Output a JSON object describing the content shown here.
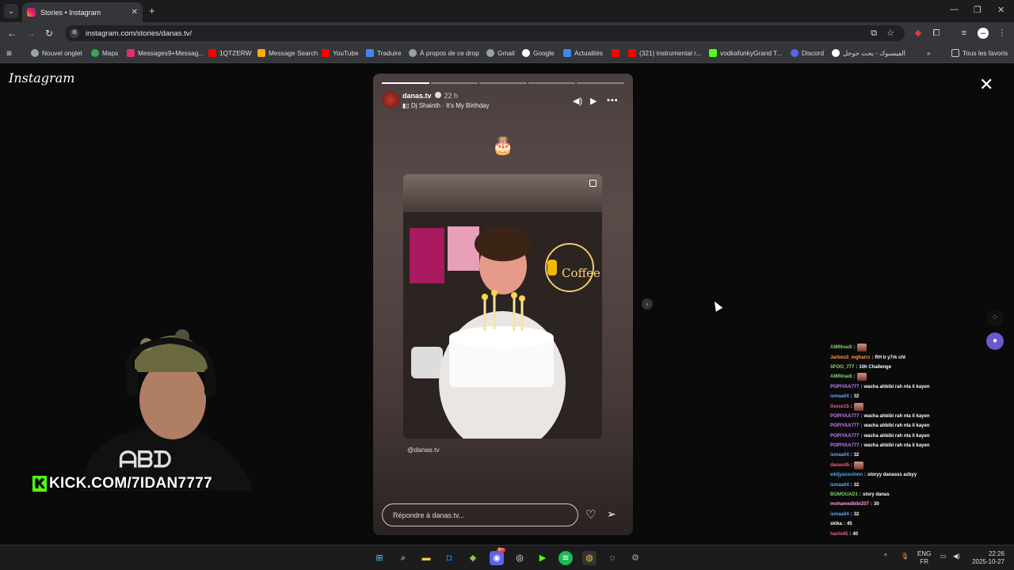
{
  "browser": {
    "tab_title": "Stories • Instagram",
    "url": "instagram.com/stories/danas.tv/",
    "bookmarks": [
      "Nouvel onglet",
      "Maps",
      "Messages9+Messag...",
      "1QTZERW",
      "Message Search",
      "YouTube",
      "Traduire",
      "À propos de ce drop",
      "Gmail",
      "Google",
      "Actualités",
      "(321) instrumental r...",
      "vodkafunkyGrand T...",
      "Discord",
      "الفيسبوك - بحث جوجل",
      "Tous les favoris"
    ],
    "accent_color": "#e1306c"
  },
  "instagram": {
    "logo": "Instagram",
    "story": {
      "username": "danas.tv",
      "time": "22 h",
      "song": "Dj Shainth · It's My Birthday",
      "sticker": "🎂",
      "mention": "@danas.tv",
      "reply_placeholder": "Répondre à danas.tv...",
      "progress_segments": 5,
      "progress_current": 1
    }
  },
  "stream": {
    "kick_url": "KICK.COM/7IDAN7777",
    "kick_color": "#53fc18",
    "chat": [
      {
        "user": "AMINnadi",
        "color": "#7bd36b",
        "text": "",
        "emote": true
      },
      {
        "user": "Jarbou3_mgharrz",
        "color": "#ff9f3a",
        "text": "RH b y7rk cht",
        "emote": false
      },
      {
        "user": "SFOO_777",
        "color": "#88e070",
        "text": "10h Challenge",
        "emote": false
      },
      {
        "user": "AMINnadi",
        "color": "#7bd36b",
        "text": "",
        "emote": true
      },
      {
        "user": "POPIYAA777",
        "color": "#c77dff",
        "text": "wacha ahbibi rah nta li kayen",
        "emote": false
      },
      {
        "user": "ismaa04",
        "color": "#5aa7ff",
        "text": "32",
        "emote": false
      },
      {
        "user": "Ilvoxx15",
        "color": "#ff5a8a",
        "text": "",
        "emote": true
      },
      {
        "user": "POPIYAA777",
        "color": "#c77dff",
        "text": "wacha ahbibi rah nta li kayen",
        "emote": false
      },
      {
        "user": "POPIYAA777",
        "color": "#c77dff",
        "text": "wacha ahbibi rah nta li kayen",
        "emote": false
      },
      {
        "user": "POPIYAA777",
        "color": "#c77dff",
        "text": "wacha ahbibi rah nta li kayen",
        "emote": false
      },
      {
        "user": "POPIYAA777",
        "color": "#c77dff",
        "text": "wacha ahbibi rah nta li kayen",
        "emote": false
      },
      {
        "user": "ismaa04",
        "color": "#5aa7ff",
        "text": "32",
        "emote": false
      },
      {
        "user": "danas45",
        "color": "#ff5a8a",
        "text": "",
        "emote": true
      },
      {
        "user": "wbljyassvinnn",
        "color": "#5aa7ff",
        "text": "storyy danasss azbyy",
        "emote": false
      },
      {
        "user": "ismaa04",
        "color": "#5aa7ff",
        "text": "32",
        "emote": false
      },
      {
        "user": "BGMOUAD1",
        "color": "#7bd36b",
        "text": "story danas",
        "emote": false
      },
      {
        "user": "mohamedbibi207",
        "color": "#ff9fd6",
        "text": "30",
        "emote": false
      },
      {
        "user": "ismaa04",
        "color": "#5aa7ff",
        "text": "32",
        "emote": false
      },
      {
        "user": "skika",
        "color": "#ffffff",
        "text": "45",
        "emote": false
      },
      {
        "user": "hachi45",
        "color": "#ff5a8a",
        "text": "40",
        "emote": false
      }
    ]
  },
  "taskbar": {
    "lang_top": "ENG",
    "lang_bottom": "FR",
    "time": "22:26",
    "date": "2025-10-27",
    "notification_badge": "9+"
  }
}
